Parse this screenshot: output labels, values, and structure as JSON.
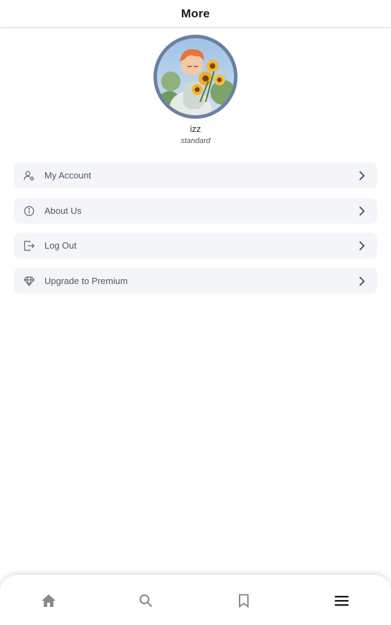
{
  "header": {
    "title": "More"
  },
  "profile": {
    "username": "izz",
    "plan": "standard",
    "avatar_icon": "avatar-illustration"
  },
  "menu": {
    "items": [
      {
        "label": "My Account",
        "icon": "account-icon"
      },
      {
        "label": "About Us",
        "icon": "info-icon"
      },
      {
        "label": "Log Out",
        "icon": "logout-icon"
      },
      {
        "label": "Upgrade to Premium",
        "icon": "diamond-icon"
      }
    ]
  },
  "bottom_nav": {
    "items": [
      {
        "icon": "home-icon",
        "active": false
      },
      {
        "icon": "search-icon",
        "active": false
      },
      {
        "icon": "bookmark-icon",
        "active": false
      },
      {
        "icon": "menu-icon",
        "active": true
      }
    ]
  },
  "colors": {
    "avatar_ring": "#6b7fa3",
    "menu_background": "#f3f5f9",
    "icon_stroke": "#5d6472",
    "chevron": "#3b4a66",
    "nav_inactive": "#8a8a8a",
    "nav_active": "#1a1a1a"
  }
}
